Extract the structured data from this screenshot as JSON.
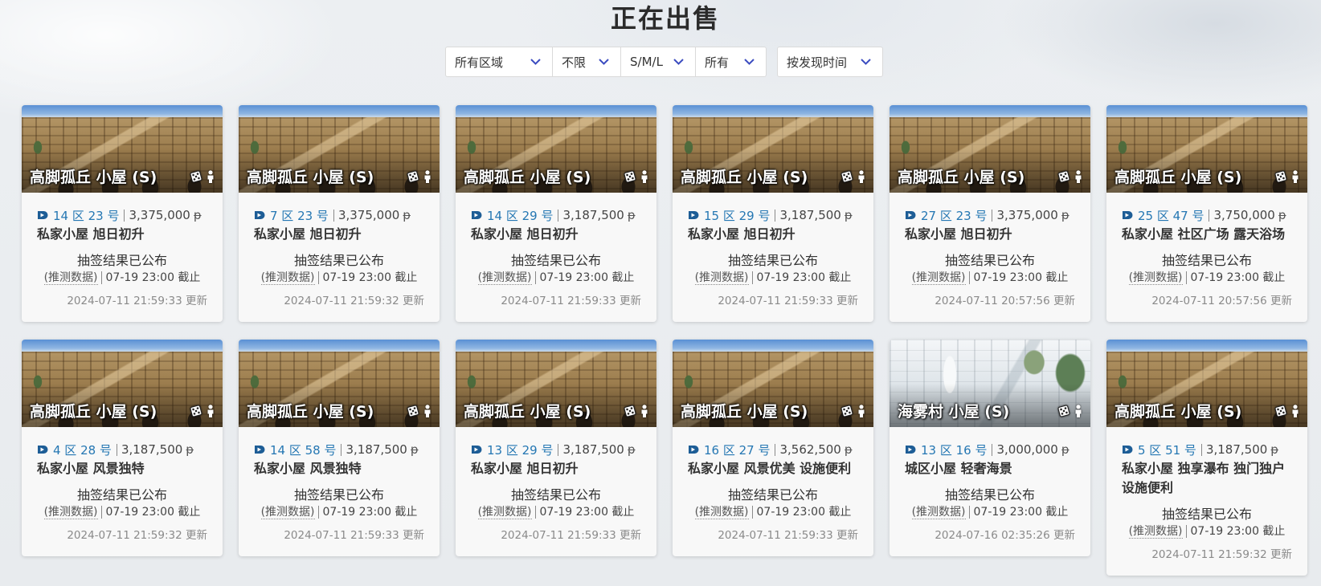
{
  "page_title": "正在出售",
  "colors": {
    "accent": "#3b4cc0",
    "location_text": "#2577b3"
  },
  "currency": "ᵽ",
  "filters": {
    "region": "所有区域",
    "limit": "不限",
    "size": "S/M/L",
    "type": "所有",
    "sort": "按发现时间"
  },
  "cards": [
    {
      "title": "高脚孤丘 小屋 (S)",
      "thumbnail": "sandstone-town",
      "location": "14 区 23 号",
      "price": "3,375,000",
      "description": "私家小屋 旭日初升",
      "status": "抽签结果已公布",
      "estimate_note": "(推测数据)",
      "deadline": "07-19 23:00 截止",
      "updated": "2024-07-11 21:59:33 更新"
    },
    {
      "title": "高脚孤丘 小屋 (S)",
      "thumbnail": "sandstone-town",
      "location": "7 区 23 号",
      "price": "3,375,000",
      "description": "私家小屋 旭日初升",
      "status": "抽签结果已公布",
      "estimate_note": "(推测数据)",
      "deadline": "07-19 23:00 截止",
      "updated": "2024-07-11 21:59:32 更新"
    },
    {
      "title": "高脚孤丘 小屋 (S)",
      "thumbnail": "sandstone-town",
      "location": "14 区 29 号",
      "price": "3,187,500",
      "description": "私家小屋 旭日初升",
      "status": "抽签结果已公布",
      "estimate_note": "(推测数据)",
      "deadline": "07-19 23:00 截止",
      "updated": "2024-07-11 21:59:33 更新"
    },
    {
      "title": "高脚孤丘 小屋 (S)",
      "thumbnail": "sandstone-town",
      "location": "15 区 29 号",
      "price": "3,187,500",
      "description": "私家小屋 旭日初升",
      "status": "抽签结果已公布",
      "estimate_note": "(推测数据)",
      "deadline": "07-19 23:00 截止",
      "updated": "2024-07-11 21:59:33 更新"
    },
    {
      "title": "高脚孤丘 小屋 (S)",
      "thumbnail": "sandstone-town",
      "location": "27 区 23 号",
      "price": "3,375,000",
      "description": "私家小屋 旭日初升",
      "status": "抽签结果已公布",
      "estimate_note": "(推测数据)",
      "deadline": "07-19 23:00 截止",
      "updated": "2024-07-11 20:57:56 更新"
    },
    {
      "title": "高脚孤丘 小屋 (S)",
      "thumbnail": "sandstone-town",
      "location": "25 区 47 号",
      "price": "3,750,000",
      "description": "私家小屋 社区广场 露天浴场",
      "status": "抽签结果已公布",
      "estimate_note": "(推测数据)",
      "deadline": "07-19 23:00 截止",
      "updated": "2024-07-11 20:57:56 更新"
    },
    {
      "title": "高脚孤丘 小屋 (S)",
      "thumbnail": "sandstone-town",
      "location": "4 区 28 号",
      "price": "3,187,500",
      "description": "私家小屋 风景独特",
      "status": "抽签结果已公布",
      "estimate_note": "(推测数据)",
      "deadline": "07-19 23:00 截止",
      "updated": "2024-07-11 21:59:32 更新"
    },
    {
      "title": "高脚孤丘 小屋 (S)",
      "thumbnail": "sandstone-town",
      "location": "14 区 58 号",
      "price": "3,187,500",
      "description": "私家小屋 风景独特",
      "status": "抽签结果已公布",
      "estimate_note": "(推测数据)",
      "deadline": "07-19 23:00 截止",
      "updated": "2024-07-11 21:59:33 更新"
    },
    {
      "title": "高脚孤丘 小屋 (S)",
      "thumbnail": "sandstone-town",
      "location": "13 区 29 号",
      "price": "3,187,500",
      "description": "私家小屋 旭日初升",
      "status": "抽签结果已公布",
      "estimate_note": "(推测数据)",
      "deadline": "07-19 23:00 截止",
      "updated": "2024-07-11 21:59:33 更新"
    },
    {
      "title": "高脚孤丘 小屋 (S)",
      "thumbnail": "sandstone-town",
      "location": "16 区 27 号",
      "price": "3,562,500",
      "description": "私家小屋 风景优美 设施便利",
      "status": "抽签结果已公布",
      "estimate_note": "(推测数据)",
      "deadline": "07-19 23:00 截止",
      "updated": "2024-07-11 21:59:33 更新"
    },
    {
      "title": "海雾村 小屋 (S)",
      "thumbnail": "white-seaside-town",
      "location": "13 区 16 号",
      "price": "3,000,000",
      "description": "城区小屋 轻奢海景",
      "status": "抽签结果已公布",
      "estimate_note": "(推测数据)",
      "deadline": "07-19 23:00 截止",
      "updated": "2024-07-16 02:35:26 更新"
    },
    {
      "title": "高脚孤丘 小屋 (S)",
      "thumbnail": "sandstone-town",
      "location": "5 区 51 号",
      "price": "3,187,500",
      "description": "私家小屋 独享瀑布 独门独户 设施便利",
      "status": "抽签结果已公布",
      "estimate_note": "(推测数据)",
      "deadline": "07-19 23:00 截止",
      "updated": "2024-07-11 21:59:32 更新"
    }
  ]
}
